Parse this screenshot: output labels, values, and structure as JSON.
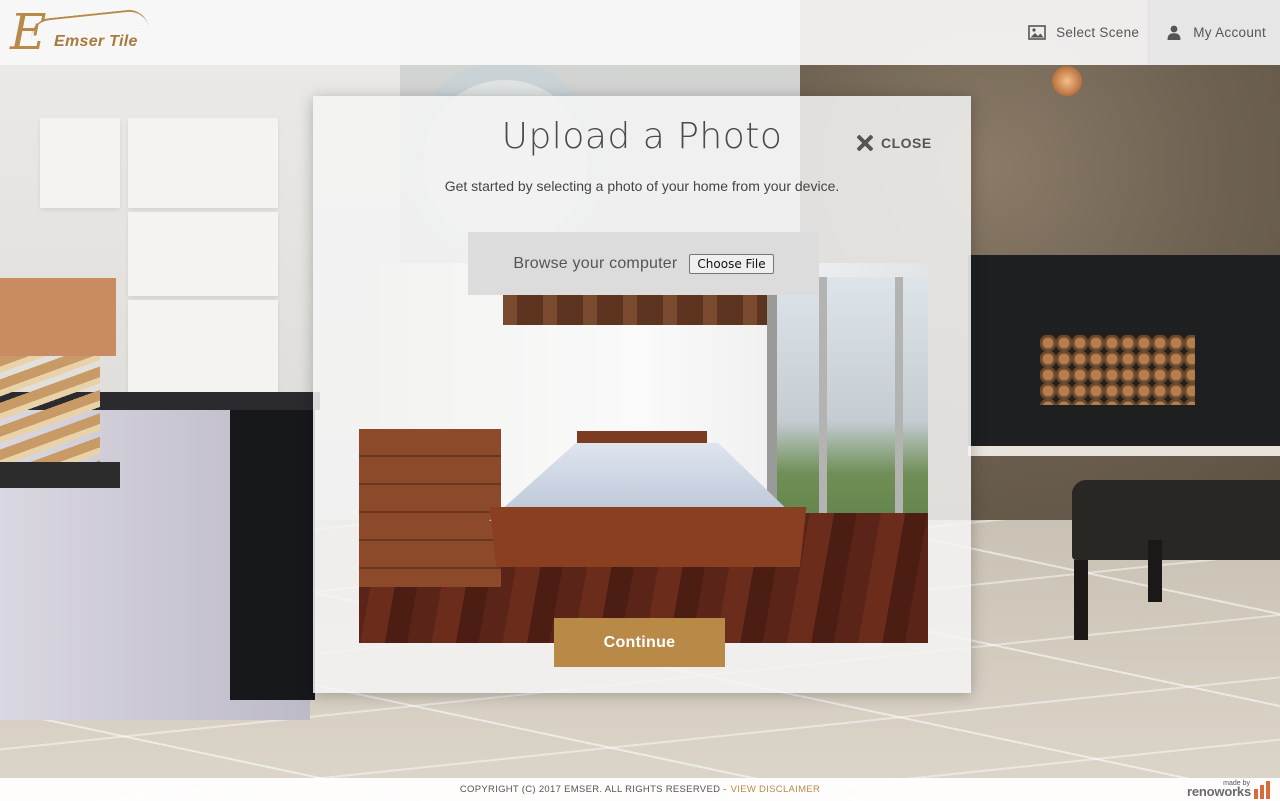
{
  "header": {
    "logo_text": "Emser Tile",
    "logo_letter": "E",
    "nav": [
      {
        "label": "Select Scene",
        "icon": "image-icon"
      },
      {
        "label": "My Account",
        "icon": "user-icon"
      }
    ]
  },
  "modal": {
    "title": "Upload a Photo",
    "close_label": "CLOSE",
    "subtitle": "Get started by selecting a photo of your home from your device.",
    "browse_label": "Browse your computer",
    "file_button": "Choose File",
    "continue_label": "Continue"
  },
  "footer": {
    "copyright": "COPYRIGHT (C) 2017 EMSER. ALL RIGHTS RESERVED -",
    "disclaimer_link": "VIEW DISCLAIMER",
    "made_by_small": "made by",
    "made_by_brand": "renoworks"
  },
  "colors": {
    "accent": "#b98a47",
    "header_bg": "#f8f8f7",
    "account_bg": "#e6e6e6"
  }
}
